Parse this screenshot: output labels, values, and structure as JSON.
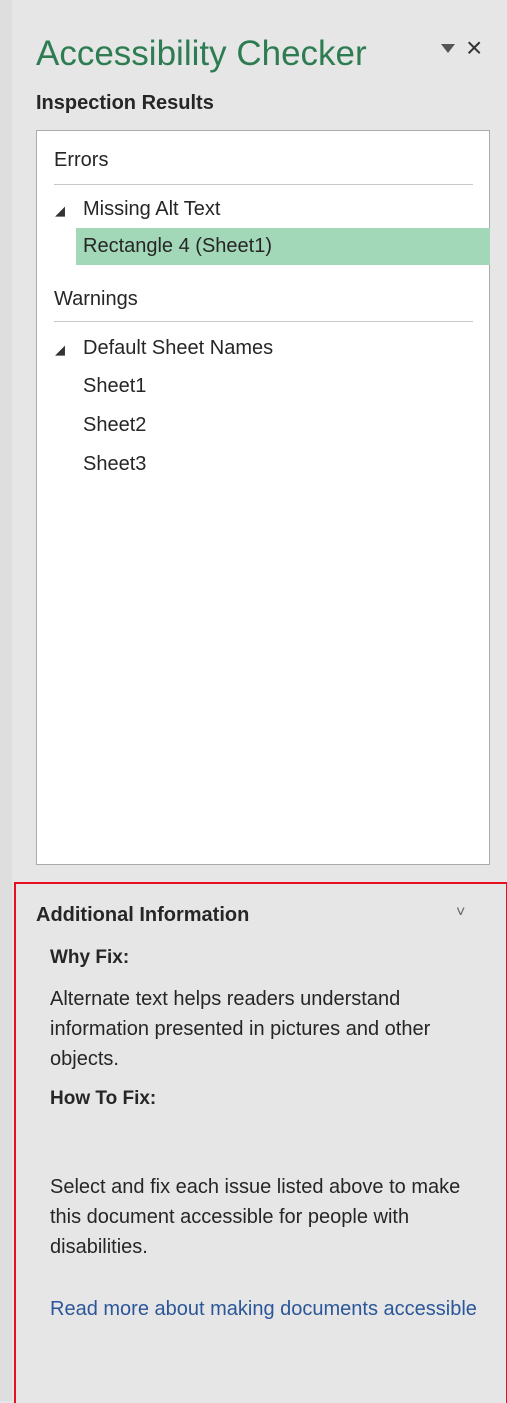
{
  "pane": {
    "title": "Accessibility Checker",
    "dropdown_icon": "triangle-down-icon",
    "close_label": "×",
    "subtitle": "Inspection Results"
  },
  "results": {
    "errors_header": "Errors",
    "errors_group": {
      "label": "Missing Alt Text",
      "expander": "◢",
      "items": [
        "Rectangle 4 (Sheet1)"
      ]
    },
    "warnings_header": "Warnings",
    "warnings_group": {
      "label": "Default Sheet Names",
      "expander": "◢",
      "items": [
        "Sheet1",
        "Sheet2",
        "Sheet3"
      ]
    }
  },
  "info": {
    "title": "Additional Information",
    "chevron": "˅",
    "why_heading": "Why Fix:",
    "why_text": "Alternate text helps readers understand information presented in pictures and other objects.",
    "how_heading": "How To Fix:",
    "how_text": "Select and fix each issue listed above to make this document accessible for people with disabilities.",
    "link_text": "Read more about making documents accessible"
  },
  "colors": {
    "title": "#2e7d52",
    "selected_row": "#a2d7b8",
    "highlight_border": "#e81123",
    "link": "#2b579a"
  }
}
